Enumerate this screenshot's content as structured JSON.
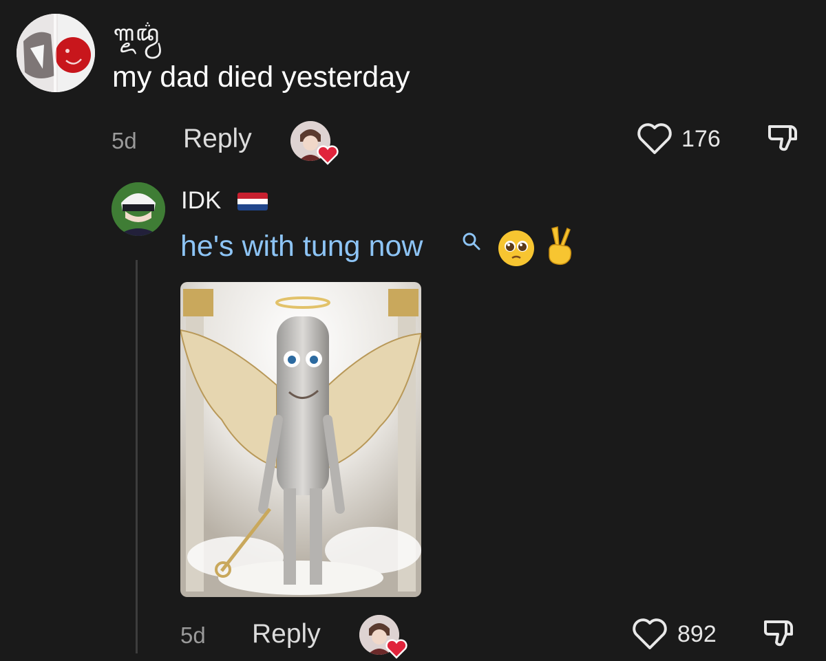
{
  "main_comment": {
    "username": "ꦒ꧀ꦌꦢ꧀ꦮ꦳",
    "text": "my dad died yesterday",
    "time": "5d",
    "reply_label": "Reply",
    "likes": "176"
  },
  "reply_comment": {
    "username": "IDK",
    "text": "he's with tung now",
    "emoji_1": "🥹",
    "emoji_2": "✌",
    "time": "5d",
    "reply_label": "Reply",
    "likes": "892"
  },
  "colors": {
    "background": "#1a1a1a",
    "link_text": "#8dc4f5",
    "heart_badge": "#e0243c"
  },
  "icons": [
    "heart-outline-icon",
    "dislike-icon",
    "search-icon",
    "netherlands-flag-icon",
    "heart-badge-icon"
  ]
}
